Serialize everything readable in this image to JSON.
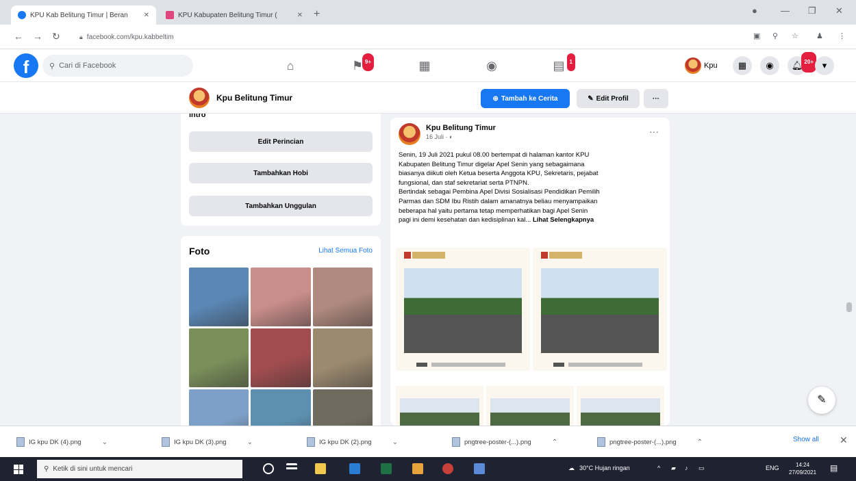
{
  "browser": {
    "tabs": [
      {
        "title": "KPU Kab Belitung Timur | Beran",
        "color": "#1877f2"
      },
      {
        "title": "KPU Kabupaten Belitung Timur (",
        "color": "#e0457b"
      }
    ],
    "new_tab": "+",
    "url": "facebook.com/kpu.kabbeltim"
  },
  "fb": {
    "logo": "f",
    "search_placeholder": "Cari di Facebook",
    "nav": [
      {
        "icon": "home-icon",
        "glyph": "⌂",
        "badge": ""
      },
      {
        "icon": "pages-icon",
        "glyph": "⚑",
        "badge": "9+"
      },
      {
        "icon": "marketplace-icon",
        "glyph": "▦",
        "badge": ""
      },
      {
        "icon": "groups-icon",
        "glyph": "◉",
        "badge": ""
      },
      {
        "icon": "gaming-icon",
        "glyph": "▤",
        "badge": "1"
      }
    ],
    "profile_name": "Kpu",
    "notif_badge": "20+"
  },
  "page": {
    "name": "Kpu Belitung Timur",
    "add_story_label": "Tambah ke Cerita",
    "edit_profile_label": "Edit Profil",
    "more_label": "···"
  },
  "intro": {
    "clipped_heading": "Intro",
    "buttons": [
      "Edit Perincian",
      "Tambahkan Hobi",
      "Tambahkan Unggulan"
    ]
  },
  "photos": {
    "title": "Foto",
    "see_all": "Lihat Semua Foto",
    "tiles": [
      "#5a87b5",
      "#c98d8a",
      "#b08a7e",
      "#7a8f5a",
      "#a14d4f",
      "#9c8a70",
      "#7da0c8",
      "#5d8fb0",
      "#6f6b5e"
    ]
  },
  "post": {
    "author": "Kpu Belitung Timur",
    "time": "16 Juli · ◐",
    "more": "···",
    "text_lines": [
      "Senin, 19 Juli 2021 pukul 08.00 bertempat di halaman kantor KPU",
      "Kabupaten Belitung Timur digelar Apel Senin yang sebagaimana",
      "biasanya diikuti oleh Ketua beserta Anggota KPU, Sekretaris, pejabat",
      "fungsional, dan staf sekretariat serta PTNPN.",
      "Bertindak sebagai Pembina Apel Divisi Sosialisasi Pendidikan Pemilih",
      "Parmas dan SDM Ibu Ristih dalam amanatnya beliau menyampaikan",
      "beberapa hal yaitu pertama tetap memperhatikan bagi Apel Senin",
      "pagi ini demi kesehatan dan kedisiplinan kal..."
    ],
    "see_more": "Lihat Selengkapnya"
  },
  "downloads": {
    "items": [
      "IG kpu DK (4).png",
      "IG kpu DK (3).png",
      "IG kpu DK (2).png",
      "pngtree-poster-(...).png",
      "pngtree-poster-(...).png"
    ],
    "show_all": "Show all"
  },
  "taskbar": {
    "search_placeholder": "Ketik di sini untuk mencari",
    "weather": "30°C Hujan ringan",
    "lang": "ENG",
    "time": "14:24",
    "date": "27/09/2021"
  }
}
